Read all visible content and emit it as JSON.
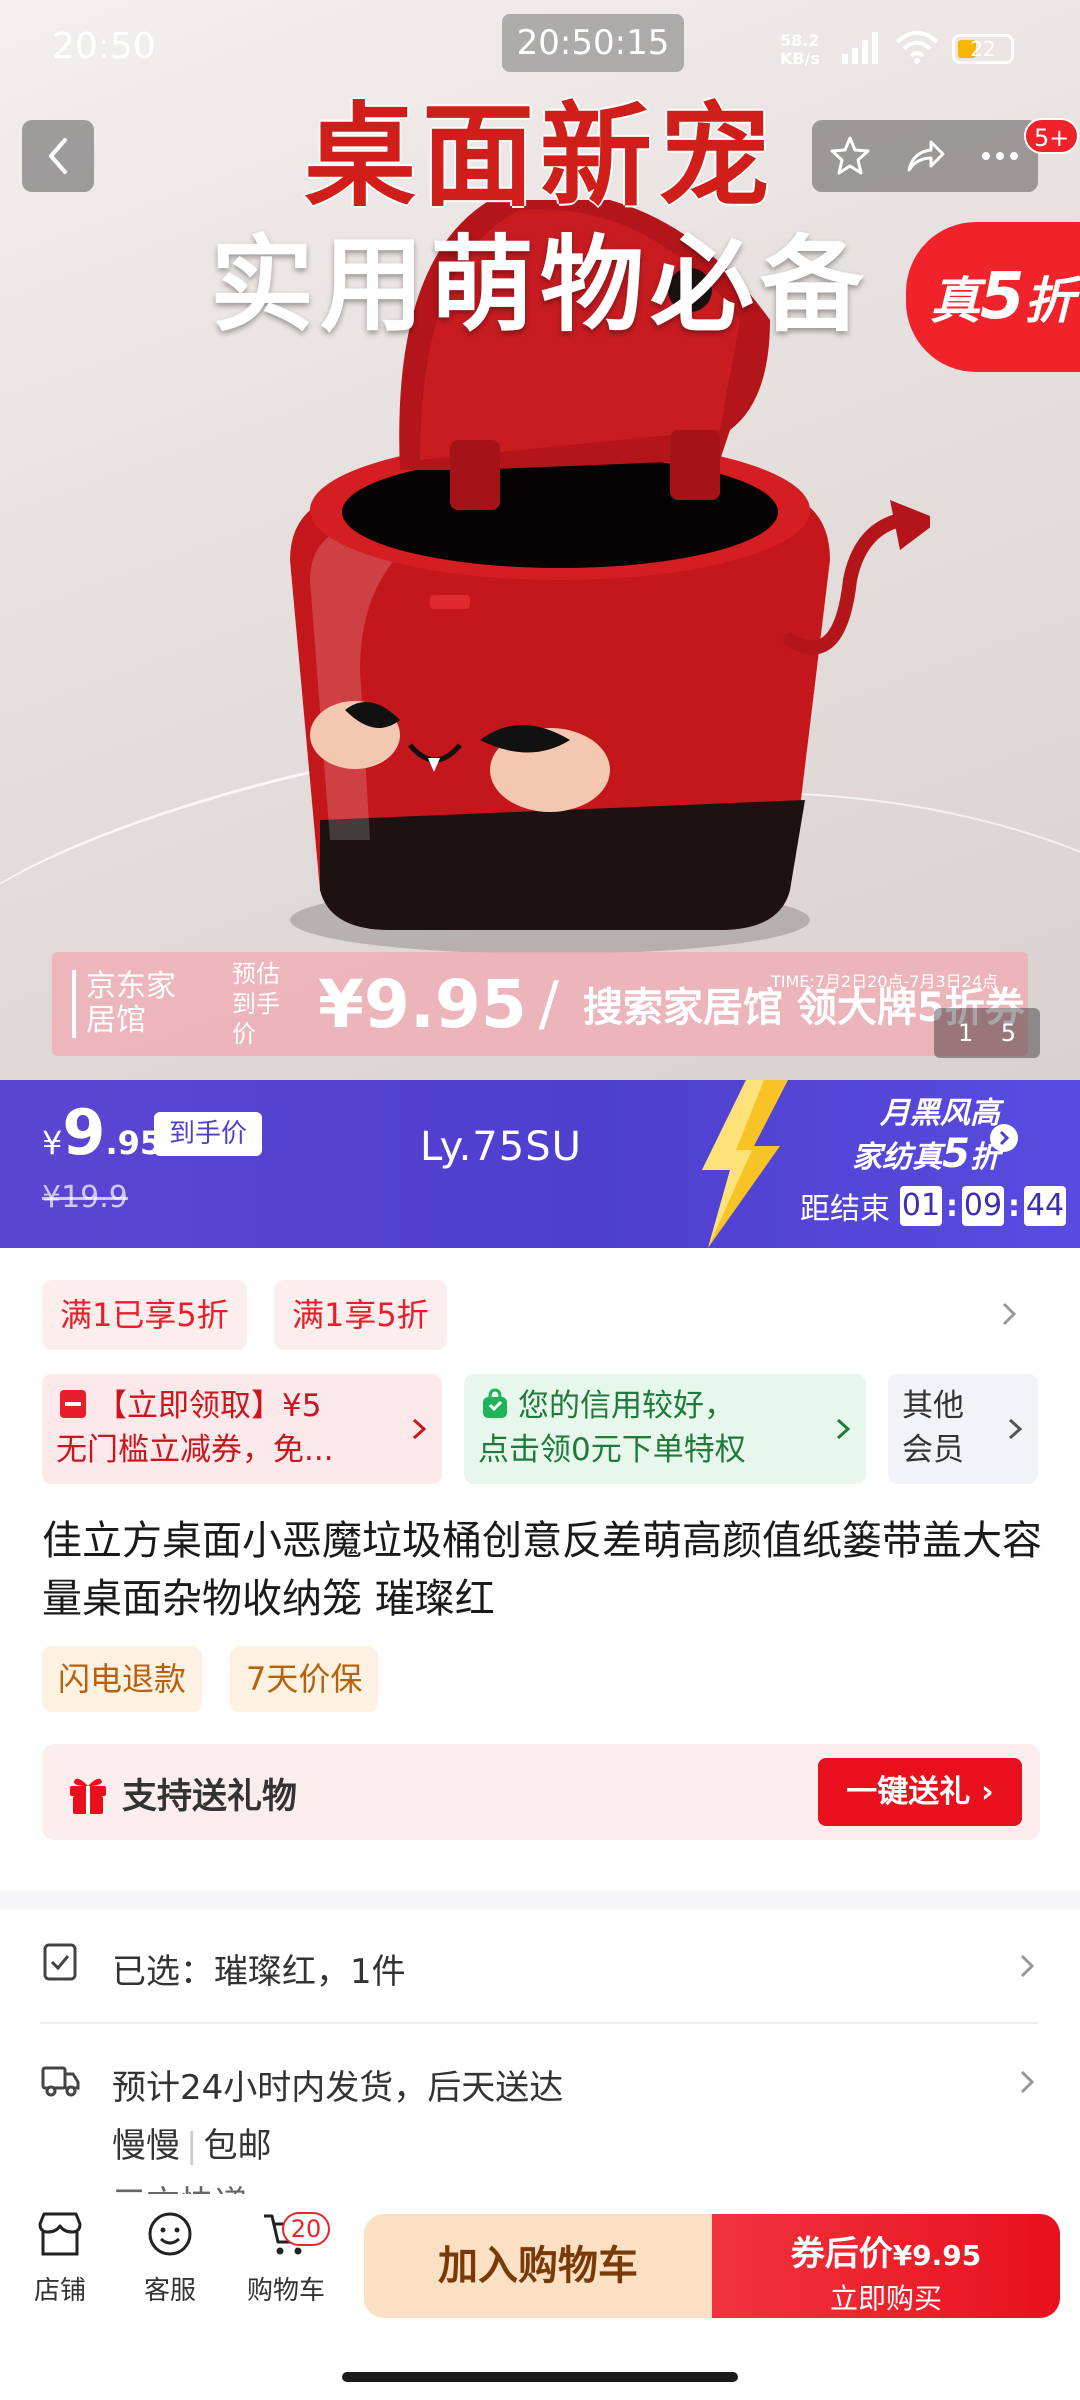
{
  "status_bar": {
    "time": "20:50",
    "clock_overlay": "20:50:15",
    "net_speed_value": "58.2",
    "net_speed_unit": "KB/s",
    "battery": "22"
  },
  "hero": {
    "headline1": "桌面新宠",
    "headline2": "实用萌物必备",
    "discount_prefix": "真",
    "discount_value": "5",
    "discount_suffix": "折",
    "banner_brand": "京东家居馆",
    "banner_est": "预估到手价",
    "banner_price": "¥9.95",
    "banner_slash": "/",
    "banner_slogan": "搜索家居馆 领大牌5折券",
    "banner_time": "TIME:7月2日20点-7月3日24点",
    "page_current": "1",
    "page_total": "5",
    "message_badge": "5+"
  },
  "price_bar": {
    "yen": "¥",
    "price_int": "9",
    "price_dec": ".95",
    "net_price_label": "到手价",
    "original_price": "¥19.9",
    "watermark": "Ly.75SU",
    "promo_line1": "月黑风高",
    "promo_line2_prefix": "家纺真",
    "promo_line2_num": "5",
    "promo_line2_suffix": "折",
    "countdown_label": "距结束",
    "countdown_h": "01",
    "countdown_m": "09",
    "countdown_s": "44",
    "colors": {
      "bar": "#4e3fcf",
      "bolt": "#f7c325"
    }
  },
  "coupons": {
    "tag1": "满1已享5折",
    "tag2": "满1享5折"
  },
  "promo_cards": {
    "coupon_line1": "【立即领取】¥5",
    "coupon_line2": "无门槛立减券，免...",
    "coupon_icon": "coupon-icon",
    "credit_line1": "您的信用较好，",
    "credit_line2": "点击领0元下单特权",
    "credit_icon": "bag-icon",
    "member_line1": "其他",
    "member_line2": "会员"
  },
  "product": {
    "title": "佳立方桌面小恶魔垃圾桶创意反差萌高颜值纸篓带盖大容量桌面杂物收纳笼 璀璨红",
    "tag_refund": "闪电退款",
    "tag_price": "7天价保",
    "gift_label": "支持送礼物",
    "gift_button": "一键送礼 ›"
  },
  "options": {
    "selected": "已选：璀璨红，1件",
    "shipping": "预计24小时内发货，后天送达",
    "ship_sub_a": "慢慢",
    "ship_sub_sep": "|",
    "ship_sub_b": "包邮",
    "ship_third": "三方快递"
  },
  "bottom_nav": {
    "shop": "店铺",
    "service": "客服",
    "cart": "购物车",
    "cart_count": "20",
    "add_to_cart": "加入购物车",
    "buy_top": "券后价",
    "buy_price": "¥9.95",
    "buy_bottom": "立即购买"
  }
}
